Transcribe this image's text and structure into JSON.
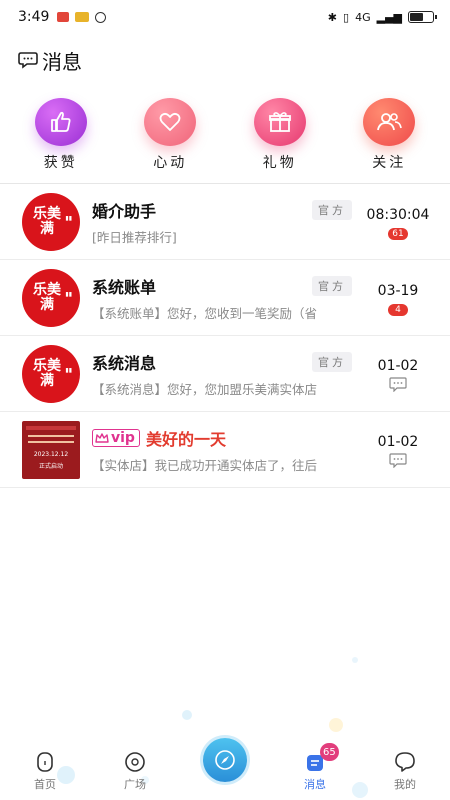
{
  "status_bar": {
    "time": "3:49",
    "signal_text": "4G"
  },
  "header": {
    "title": "消息",
    "icon": "chat-bubble-icon"
  },
  "categories": [
    {
      "label": "获赞",
      "icon": "thumbs-up-icon",
      "color": "#b43ee0"
    },
    {
      "label": "心动",
      "icon": "heart-icon",
      "color": "#f0657a"
    },
    {
      "label": "礼物",
      "icon": "gift-icon",
      "color": "#e9477a"
    },
    {
      "label": "关注",
      "icon": "followers-icon",
      "color": "#f25e4e"
    }
  ],
  "messages": [
    {
      "name": "婚介助手",
      "tag": "官方",
      "preview": "[昨日推荐排行]",
      "time": "08:30:04",
      "badge": "61",
      "avatar_text": "乐美满"
    },
    {
      "name": "系统账单",
      "tag": "官方",
      "preview": "【系统账单】您好，您收到一笔奖励（省",
      "time": "03-19",
      "badge": "4",
      "avatar_text": "乐美满"
    },
    {
      "name": "系统消息",
      "tag": "官方",
      "preview": "【系统消息】您好，您加盟乐美满实体店",
      "time": "01-02",
      "avatar_text": "乐美满"
    },
    {
      "name": "美好的一天",
      "vip_label": "vip",
      "preview": "【实体店】我已成功开通实体店了，往后",
      "time": "01-02",
      "poster_date": "2023.12.12",
      "poster_sub": "正式启动"
    }
  ],
  "tabbar": {
    "items": [
      {
        "label": "首页",
        "icon": "home-icon"
      },
      {
        "label": "广场",
        "icon": "plaza-icon"
      },
      {
        "label": "",
        "icon": "compass-icon"
      },
      {
        "label": "消息",
        "icon": "messages-icon",
        "badge": "65",
        "active": true
      },
      {
        "label": "我的",
        "icon": "profile-icon"
      }
    ]
  },
  "colors": {
    "accent": "#3a73e8",
    "badge_red": "#e5372f",
    "brand_red": "#d9141b"
  }
}
